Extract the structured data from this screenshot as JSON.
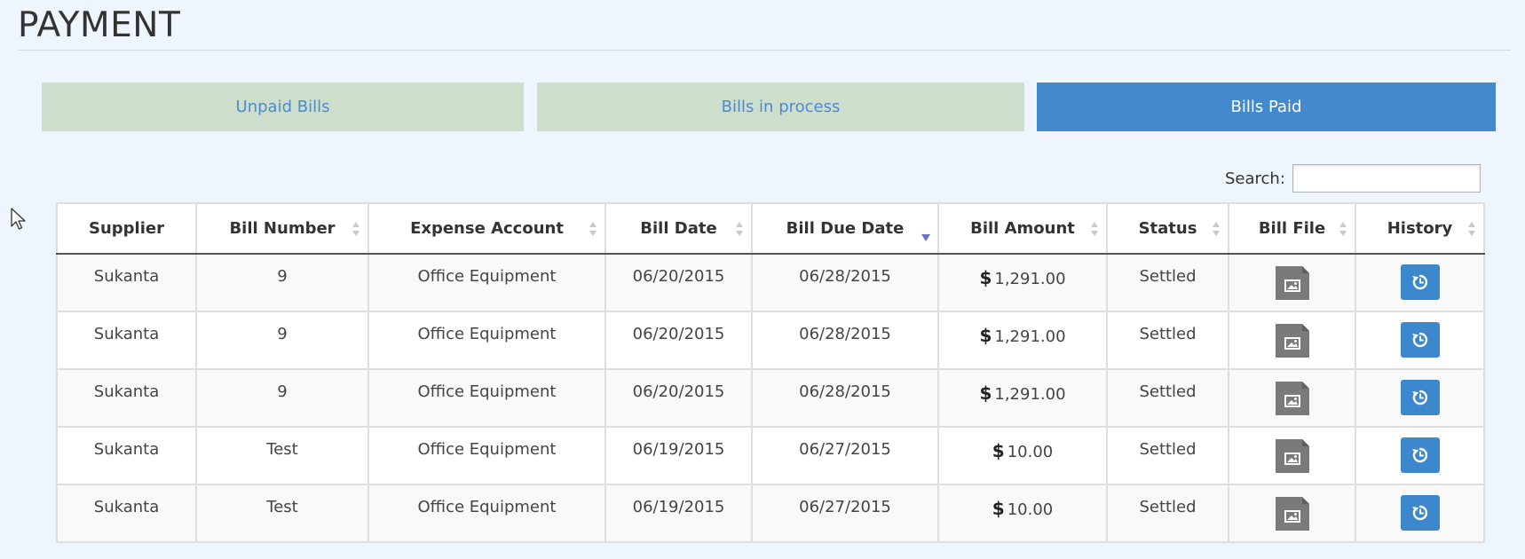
{
  "page": {
    "title": "PAYMENT"
  },
  "tabs": [
    {
      "label": "Unpaid Bills",
      "active": false
    },
    {
      "label": "Bills in process",
      "active": false
    },
    {
      "label": "Bills Paid",
      "active": true
    }
  ],
  "search": {
    "label": "Search:",
    "value": ""
  },
  "table": {
    "columns": [
      {
        "label": "Supplier",
        "sort": "none"
      },
      {
        "label": "Bill Number",
        "sort": "both"
      },
      {
        "label": "Expense Account",
        "sort": "both"
      },
      {
        "label": "Bill Date",
        "sort": "both"
      },
      {
        "label": "Bill Due Date",
        "sort": "desc"
      },
      {
        "label": "Bill Amount",
        "sort": "both"
      },
      {
        "label": "Status",
        "sort": "both"
      },
      {
        "label": "Bill File",
        "sort": "both"
      },
      {
        "label": "History",
        "sort": "both"
      }
    ],
    "rows": [
      {
        "supplier": "Sukanta",
        "bill_number": "9",
        "expense_account": "Office Equipment",
        "bill_date": "06/20/2015",
        "due_date": "06/28/2015",
        "currency": "$",
        "amount": "1,291.00",
        "status": "Settled"
      },
      {
        "supplier": "Sukanta",
        "bill_number": "9",
        "expense_account": "Office Equipment",
        "bill_date": "06/20/2015",
        "due_date": "06/28/2015",
        "currency": "$",
        "amount": "1,291.00",
        "status": "Settled"
      },
      {
        "supplier": "Sukanta",
        "bill_number": "9",
        "expense_account": "Office Equipment",
        "bill_date": "06/20/2015",
        "due_date": "06/28/2015",
        "currency": "$",
        "amount": "1,291.00",
        "status": "Settled"
      },
      {
        "supplier": "Sukanta",
        "bill_number": "Test",
        "expense_account": "Office Equipment",
        "bill_date": "06/19/2015",
        "due_date": "06/27/2015",
        "currency": "$",
        "amount": "10.00",
        "status": "Settled"
      },
      {
        "supplier": "Sukanta",
        "bill_number": "Test",
        "expense_account": "Office Equipment",
        "bill_date": "06/19/2015",
        "due_date": "06/27/2015",
        "currency": "$",
        "amount": "10.00",
        "status": "Settled"
      }
    ],
    "icons": {
      "bill_file": "image-file-icon",
      "history": "history-icon"
    }
  },
  "colors": {
    "page_background": "#eff5fc",
    "tab_inactive_bg": "#cddfcc",
    "tab_inactive_text": "#4a8ad0",
    "tab_active_bg": "#4289cd",
    "tab_active_text": "#ffffff",
    "history_button": "#3d87cc",
    "file_icon": "#7a7a7a",
    "sort_desc_arrow": "#6b73c9",
    "sort_neutral_arrow": "#c8c8c8"
  }
}
